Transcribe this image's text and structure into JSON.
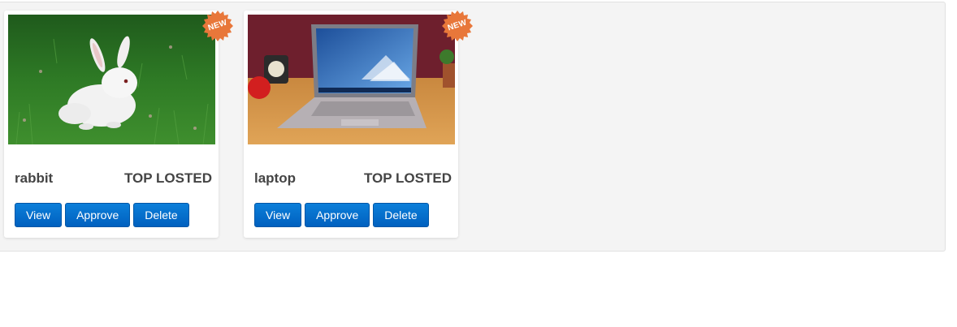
{
  "products": [
    {
      "name": "rabbit",
      "tag": "TOP LOSTED",
      "badge": "NEW",
      "image": "white rabbit on grass",
      "actions": {
        "view": "View",
        "approve": "Approve",
        "delete": "Delete"
      }
    },
    {
      "name": "laptop",
      "tag": "TOP LOSTED",
      "badge": "NEW",
      "image": "laptop on wooden desk",
      "actions": {
        "view": "View",
        "approve": "Approve",
        "delete": "Delete"
      }
    }
  ],
  "colors": {
    "button": "#0060bf",
    "badge": "#e8773a",
    "panel": "#f4f4f4"
  }
}
